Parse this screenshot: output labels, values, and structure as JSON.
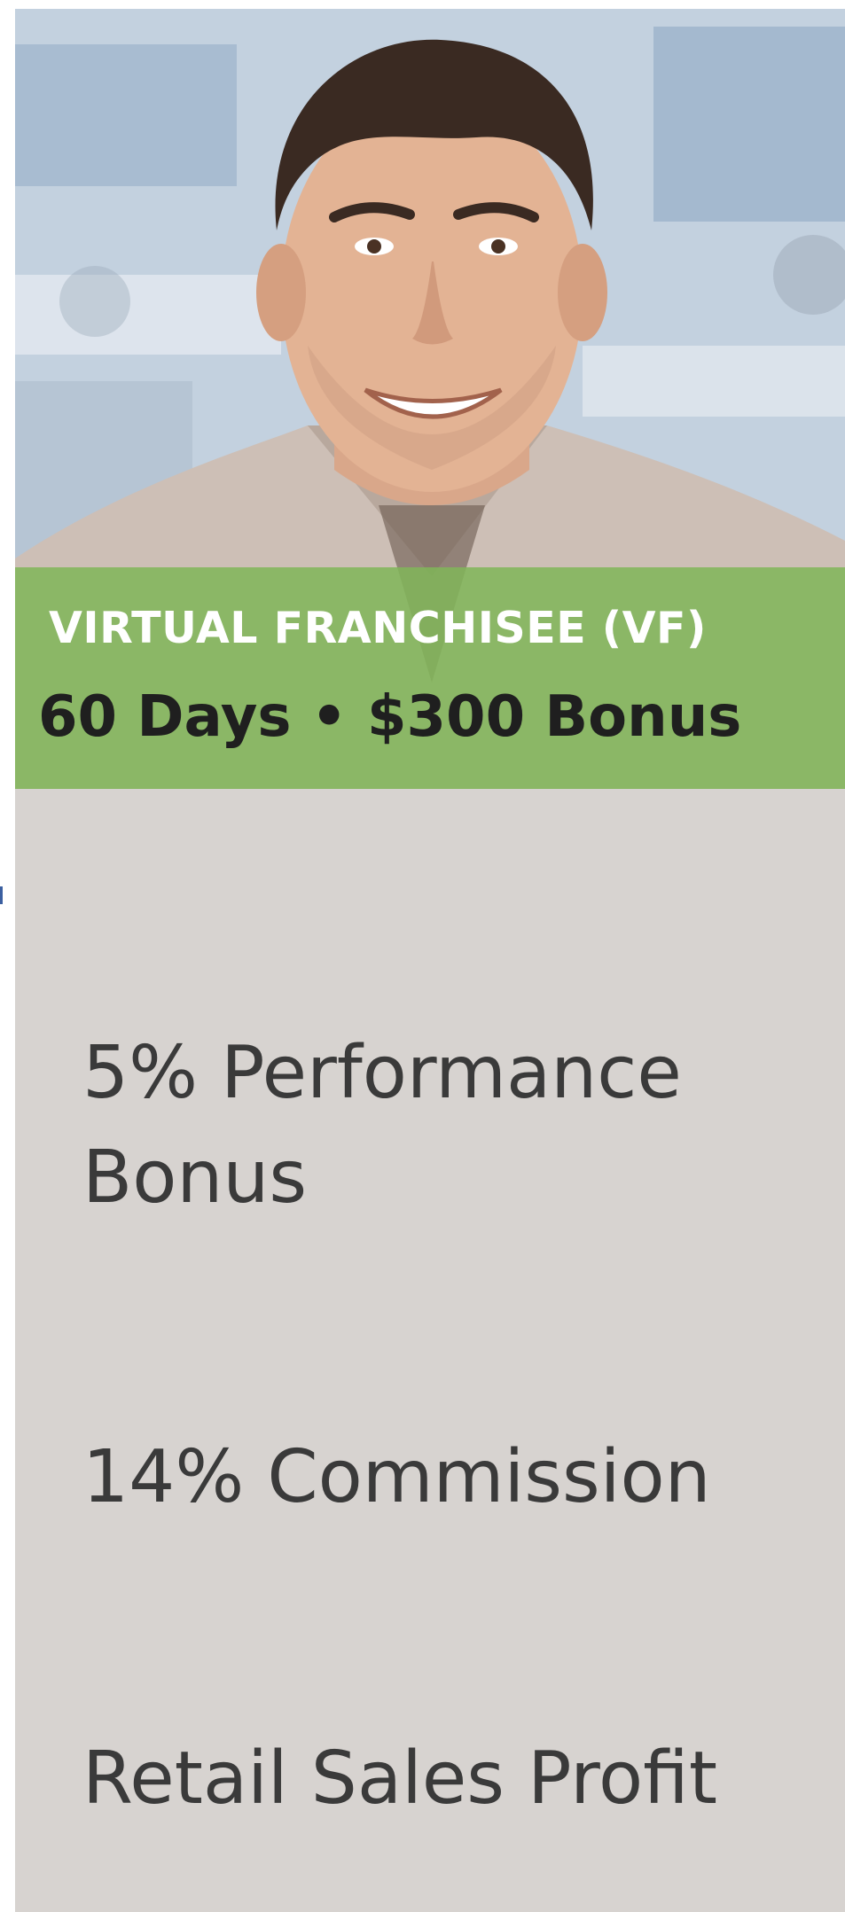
{
  "banner": {
    "title": "VIRTUAL FRANCHISEE (VF)",
    "subtitle": "60 Days • $300 Bonus"
  },
  "features": [
    {
      "label": "5% Performance Bonus"
    },
    {
      "label": "14% Commission"
    },
    {
      "label": "Retail Sales Profit"
    }
  ],
  "colors": {
    "banner_green": "#80b658",
    "card_background": "#d7d3d0",
    "feature_text": "#3a3a3a"
  }
}
